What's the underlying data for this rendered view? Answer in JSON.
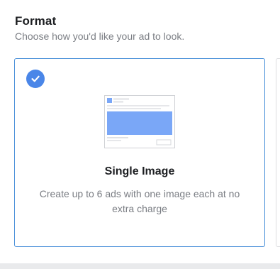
{
  "section": {
    "title": "Format",
    "subtitle": "Choose how you'd like your ad to look."
  },
  "format_option": {
    "title": "Single Image",
    "description": "Create up to 6 ads with one image each at no extra charge",
    "selected": true,
    "icon": "single-image-preview-icon",
    "check_icon": "checkmark-icon"
  },
  "colors": {
    "accent": "#4a86e8",
    "selected_border": "#4a90d9",
    "preview_blue": "#7aa7f7"
  }
}
